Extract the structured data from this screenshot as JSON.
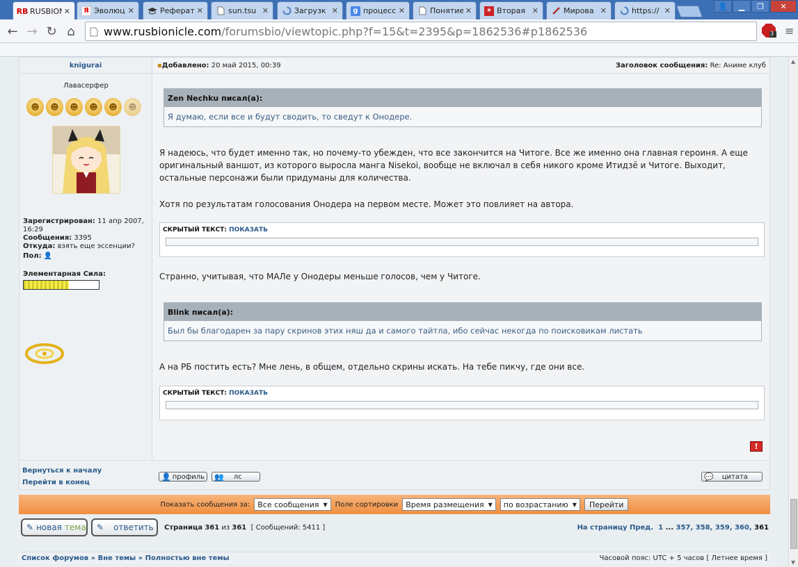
{
  "tabs": [
    {
      "favicon": "RB",
      "title": "RUSBION"
    },
    {
      "favicon": "Я",
      "title": "Эволюц"
    },
    {
      "favicon": "mortarboard-icon",
      "title": "Реферат"
    },
    {
      "favicon": "page-icon",
      "title": "sun.tsu"
    },
    {
      "favicon": "loading-icon",
      "title": "Загрузк"
    },
    {
      "favicon": "g",
      "title": "процесс"
    },
    {
      "favicon": "page-icon",
      "title": "Понятие"
    },
    {
      "favicon": "star-icon",
      "title": "Вторая"
    },
    {
      "favicon": "brush-icon",
      "title": "Мирова"
    },
    {
      "favicon": "loading-icon",
      "title": "https://"
    }
  ],
  "address": {
    "host": "www.rusbionicle.com",
    "path": "/forumsbio/viewtopic.php?f=15&t=2395&p=1862536#p1862536"
  },
  "extension_badge": "3",
  "post": {
    "author": "knigurai",
    "rank_title": "Лавасерфер",
    "posted_label": "Добавлено:",
    "posted_date": "20 май 2015, 00:39",
    "subject_label": "Заголовок сообщения:",
    "subject": "Re: Аниме клуб",
    "registered_label": "Зарегистрирован:",
    "registered": "11 апр 2007, 16:29",
    "posts_label": "Сообщения:",
    "posts": "3395",
    "from_label": "Откуда:",
    "from": "взять еще эссенции?",
    "gender_label": "Пол:",
    "power_label": "Элементарная Сила:",
    "power_fraction": 0.6,
    "quote1_author": "Zen Nechku писал(а):",
    "quote1_text": "Я думаю, если все и будут сводить, то сведут к Онодере.",
    "para1": "Я надеюсь, что будет именно так, но почему-то убежден, что все закончится на Читоге. Все же именно она главная героиня. А еще оригинальный ваншот, из которого выросла манга Nisekoi, вообще не включал в себя никого кроме Итидзё и Читоге. Выходит, остальные персонажи были придуманы для количества.",
    "para2": "Хотя по результатам голосования Онодера на первом месте. Может это повлияет на автора.",
    "hidden_label": "СКРЫТЫЙ ТЕКСТ",
    "hidden_show": "ПОКАЗАТЬ",
    "para3": "Странно, учитывая, что МАЛе у Онодеры меньше голосов, чем у Читоге.",
    "quote2_author": "Blink писал(а):",
    "quote2_text": "Был бы благодарен за пару скринов этих няш да и самого тайтла, ибо сейчас некогда по поисковикам листать",
    "para4": "А на РБ постить есть? Мне лень, в общем, отдельно скрины искать. На тебе пикчу, где они все."
  },
  "nav": {
    "back_top": "Вернуться к началу",
    "go_end": "Перейти в конец",
    "profile_btn": "профиль",
    "pm_btn": "лс",
    "quote_btn": "цитата"
  },
  "sort": {
    "show_label": "Показать сообщения за:",
    "show_value": "Все сообщения",
    "sort_label": "Поле сортировки",
    "sort_value": "Время размещения",
    "order_value": "по возрастанию",
    "go": "Перейти"
  },
  "pagination": {
    "new_topic_a": "новая",
    "new_topic_b": "тема",
    "reply": "ответить",
    "page_label": "Страница",
    "page_cur": "361",
    "page_of": "из",
    "page_total": "361",
    "msgs": "[ Сообщений: 5411 ]",
    "goto_label": "На страницу",
    "prev": "Пред.",
    "p1": "1",
    "ellipsis": "...",
    "p357": "357",
    "p358": "358",
    "p359": "359",
    "p360": "360",
    "p361": "361"
  },
  "footer": {
    "crumb1": "Список форумов",
    "crumb2": "Вне темы",
    "crumb3": "Полностью вне темы",
    "sep": "»",
    "timezone": "Часовой пояс: UTC + 5 часов [ Летнее время ]"
  },
  "colors": {
    "accent_link": "#2a5a8a",
    "sortbar": "#ef8f40",
    "tabbar": "#3d6fb5"
  }
}
